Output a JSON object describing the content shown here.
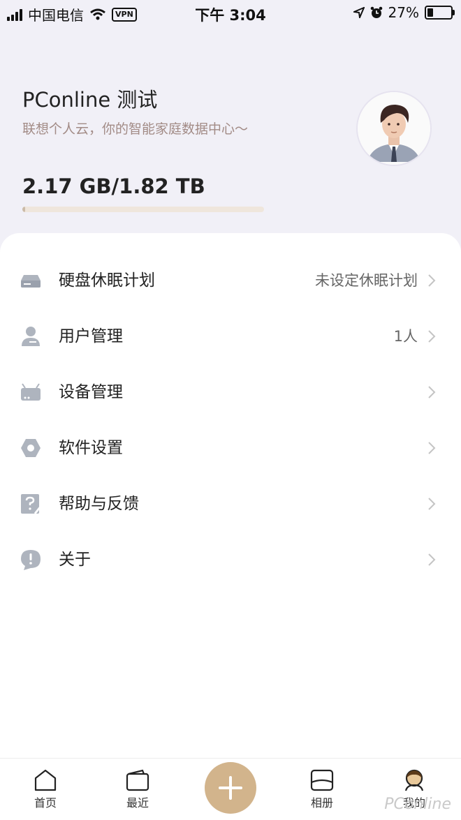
{
  "status_bar": {
    "carrier": "中国电信",
    "vpn": "VPN",
    "time": "下午 3:04",
    "battery": "27%",
    "battery_level": 0.27
  },
  "header": {
    "title": "PConline 测试",
    "subtitle": "联想个人云，你的智能家庭数据中心～",
    "storage": "2.17 GB/1.82 TB",
    "storage_used_fraction": 0.012
  },
  "menu": [
    {
      "label": "硬盘休眠计划",
      "value": "未设定休眠计划",
      "icon": "disk-icon"
    },
    {
      "label": "用户管理",
      "value": "1人",
      "icon": "user-icon"
    },
    {
      "label": "设备管理",
      "value": "",
      "icon": "router-icon"
    },
    {
      "label": "软件设置",
      "value": "",
      "icon": "gear-icon"
    },
    {
      "label": "帮助与反馈",
      "value": "",
      "icon": "help-icon"
    },
    {
      "label": "关于",
      "value": "",
      "icon": "info-icon"
    }
  ],
  "tabbar": {
    "home": "首页",
    "recent": "最近",
    "album": "相册",
    "mine": "我的"
  },
  "watermark": "PConline",
  "colors": {
    "accent": "#d2b48c",
    "background": "#f1f0f7",
    "icon": "#aeb4be"
  }
}
